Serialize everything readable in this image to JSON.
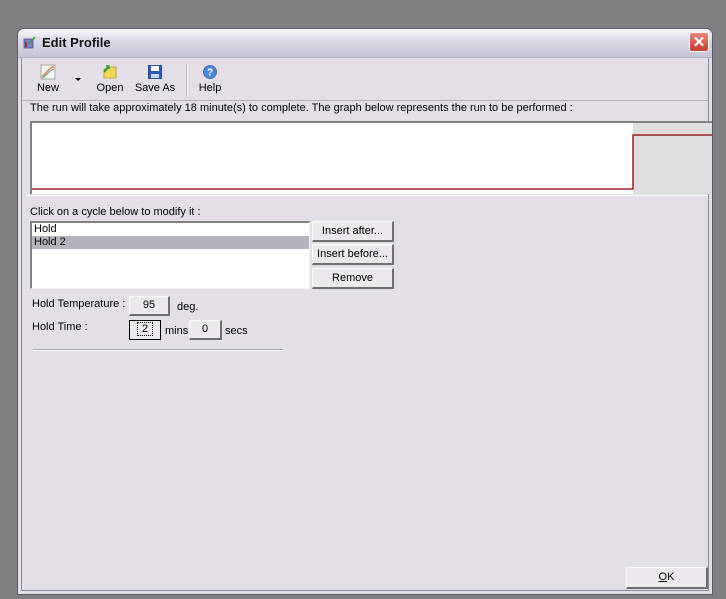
{
  "window": {
    "title": "Edit Profile",
    "close_icon": "close-icon"
  },
  "toolbar": {
    "new_label": "New",
    "open_label": "Open",
    "save_as_label": "Save As",
    "help_label": "Help",
    "icons": {
      "new": "profile-graph-icon",
      "dropdown": "dropdown-arrow-icon",
      "open": "folder-open-icon",
      "save_as": "floppy-disk-icon",
      "help": "help-icon"
    }
  },
  "run_message": "The run will take approximately 18 minute(s) to complete. The graph below represents the run to be performed :",
  "graph": {
    "line_color": "#8b0000",
    "highlight_bg": "#dedede",
    "segments": [
      {
        "name": "Hold",
        "level": "low"
      },
      {
        "name": "Hold 2",
        "level": "high",
        "selected": true
      }
    ]
  },
  "cycles": {
    "label": "Click on a cycle below to modify it :",
    "items": [
      {
        "label": "Hold",
        "selected": false
      },
      {
        "label": "Hold 2",
        "selected": true
      }
    ],
    "insert_after_label": "Insert after...",
    "insert_before_label": "Insert before...",
    "remove_label": "Remove"
  },
  "hold": {
    "temperature_label": "Hold Temperature :",
    "temperature_value": "95",
    "temperature_unit": "deg.",
    "time_label": "Hold Time :",
    "mins_value": "2",
    "mins_unit": "mins",
    "secs_value": "0",
    "secs_unit": "secs"
  },
  "footer": {
    "ok_label": "OK",
    "ok_mnemonic": "O",
    "ok_rest": "K"
  }
}
